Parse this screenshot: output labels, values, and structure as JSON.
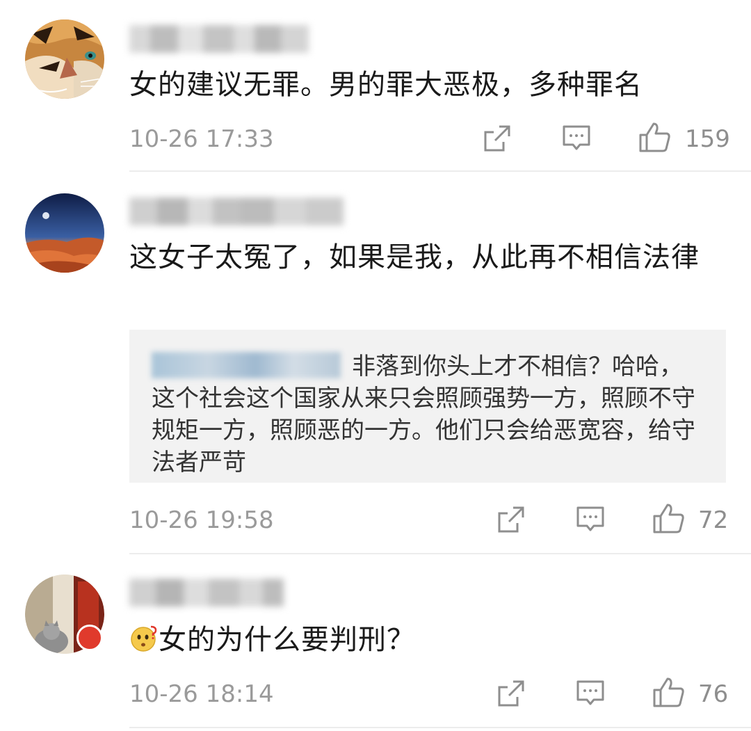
{
  "comments": [
    {
      "text": "女的建议无罪。男的罪大恶极，多种罪名",
      "time": "10-26 17:33",
      "likes": "159"
    },
    {
      "text": "这女子太冤了，如果是我，从此再不相信法律",
      "reply": "非落到你头上才不相信？哈哈，这个社会这个国家从来只会照顾强势一方，照顾不守规矩一方，照顾恶的一方。他们只会给恶宽容，给守法者严苛",
      "time": "10-26 19:58",
      "likes": "72"
    },
    {
      "text": "女的为什么要判刑？",
      "emoji": "confused-face-emoji",
      "time": "10-26 18:14",
      "likes": "76"
    }
  ],
  "icons": {
    "share": "share-icon",
    "comment": "comment-icon",
    "like": "thumbs-up-icon"
  },
  "colors": {
    "text": "#1a1a1a",
    "meta": "#9a9a9a",
    "quote_bg": "#f2f2f2",
    "divider": "#ececec"
  }
}
